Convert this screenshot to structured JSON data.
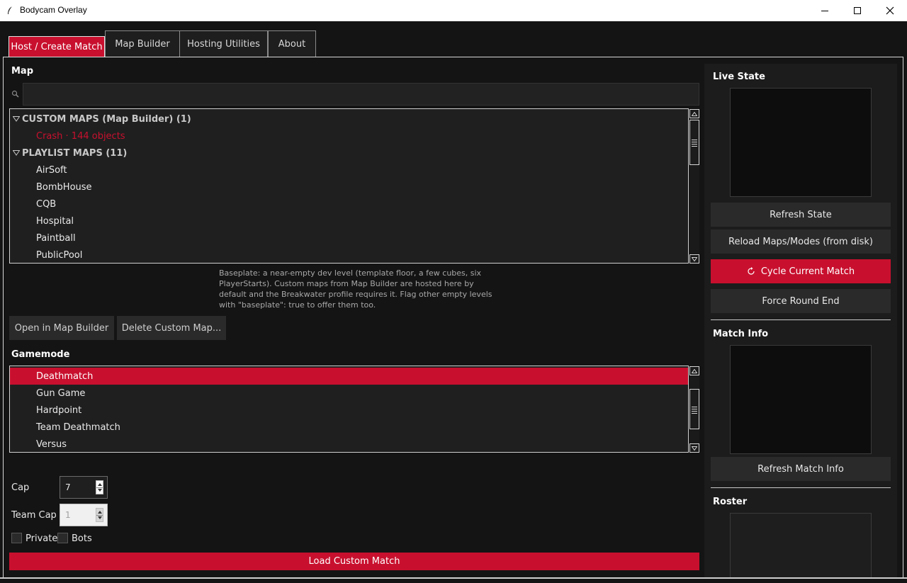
{
  "window": {
    "title": "Bodycam Overlay",
    "icon": "feather-icon",
    "controls": [
      "minimize-icon",
      "maximize-icon",
      "close-icon"
    ]
  },
  "tabs": [
    {
      "label": "Host / Create Match",
      "active": true
    },
    {
      "label": "Map Builder",
      "active": false
    },
    {
      "label": "Hosting Utilities",
      "active": false
    },
    {
      "label": "About",
      "active": false
    }
  ],
  "map": {
    "heading": "Map",
    "search": {
      "value": "",
      "placeholder": ""
    },
    "groups": [
      {
        "label": "CUSTOM MAPS (Map Builder)  (1)",
        "items": [
          "Crash  ·  144 objects"
        ]
      },
      {
        "label": "PLAYLIST MAPS  (11)",
        "items": [
          "AirSoft",
          "BombHouse",
          "CQB",
          "Hospital",
          "Paintball",
          "PublicPool"
        ]
      }
    ],
    "info": "Baseplate: a near-empty dev level (template floor, a few cubes, six PlayerStarts). Custom maps from Map Builder are hosted here by default and the Breakwater profile requires it. Flag other empty levels with \"baseplate\": true to offer them too.",
    "buttons": {
      "open": "Open in Map Builder",
      "delete": "Delete Custom Map..."
    }
  },
  "gamemode": {
    "heading": "Gamemode",
    "items": [
      "Deathmatch",
      "Gun Game",
      "Hardpoint",
      "Team Deathmatch",
      "Versus"
    ],
    "selected": "Deathmatch"
  },
  "settings": {
    "cap_label": "Cap",
    "cap_value": "7",
    "team_cap_label": "Team Cap",
    "team_cap_value": "1",
    "private_label": "Private",
    "private_checked": false,
    "bots_label": "Bots",
    "bots_checked": false
  },
  "load_button": "Load Custom Match",
  "right": {
    "live_state_heading": "Live State",
    "refresh_state": "Refresh State",
    "reload_maps": "Reload Maps/Modes (from disk)",
    "cycle_match": "Cycle Current Match",
    "force_round_end": "Force Round End",
    "match_info_heading": "Match Info",
    "refresh_match_info": "Refresh Match Info",
    "roster_heading": "Roster"
  },
  "colors": {
    "accent": "#c8102e",
    "background": "#141414",
    "panel": "#1c1c1c"
  }
}
